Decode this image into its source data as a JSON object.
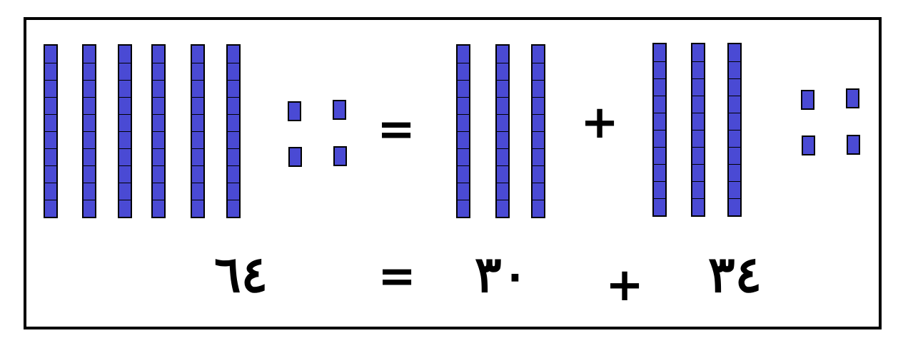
{
  "equation": {
    "operators": {
      "equals": "=",
      "plus": "+"
    },
    "numbers": {
      "total": "٦٤",
      "tens_part": "٣٠",
      "other_part": "٣٤"
    }
  },
  "colors": {
    "block_fill": "#4a4ad4",
    "outline": "#000000"
  },
  "groups": {
    "total": {
      "ten_rods": 6,
      "unit_cubes": 4
    },
    "tens_part": {
      "ten_rods": 3,
      "unit_cubes": 0
    },
    "other_part": {
      "ten_rods": 3,
      "unit_cubes": 4
    }
  },
  "rod_segments": 10
}
